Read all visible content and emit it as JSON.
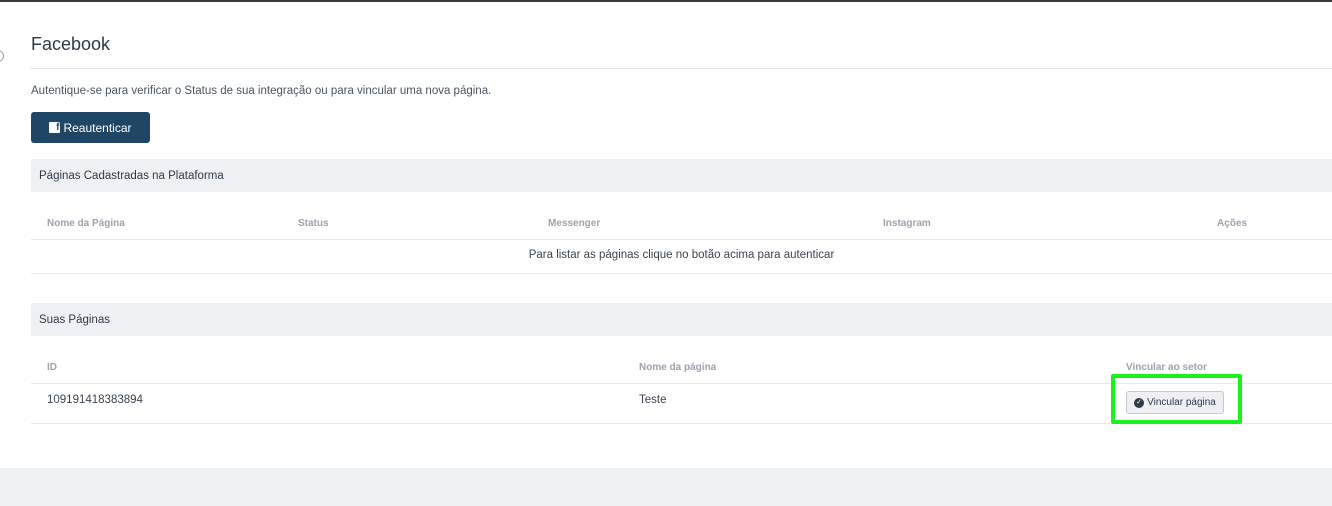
{
  "page": {
    "title": "Facebook",
    "intro": "Autentique-se para verificar o Status de sua integração ou para vincular uma nova página.",
    "reauth_label": "Reautenticar",
    "reauth_icon": "facebook-icon"
  },
  "registered_pages": {
    "header": "Páginas Cadastradas na Plataforma",
    "columns": [
      "Nome da Página",
      "Status",
      "Messenger",
      "Instagram",
      "Ações"
    ],
    "empty_message": "Para listar as páginas clique no botão acima para autenticar"
  },
  "your_pages": {
    "header": "Suas Páginas",
    "columns": [
      "ID",
      "Nome da página",
      "Vincular ao setor"
    ],
    "rows": [
      {
        "id": "109191418383894",
        "name": "Teste",
        "action_label": "Vincular página",
        "action_icon": "check-circle-icon"
      }
    ]
  },
  "colors": {
    "primary_button": "#1f4665",
    "highlight": "#1ef01e",
    "section_bg": "#eef0f3"
  }
}
